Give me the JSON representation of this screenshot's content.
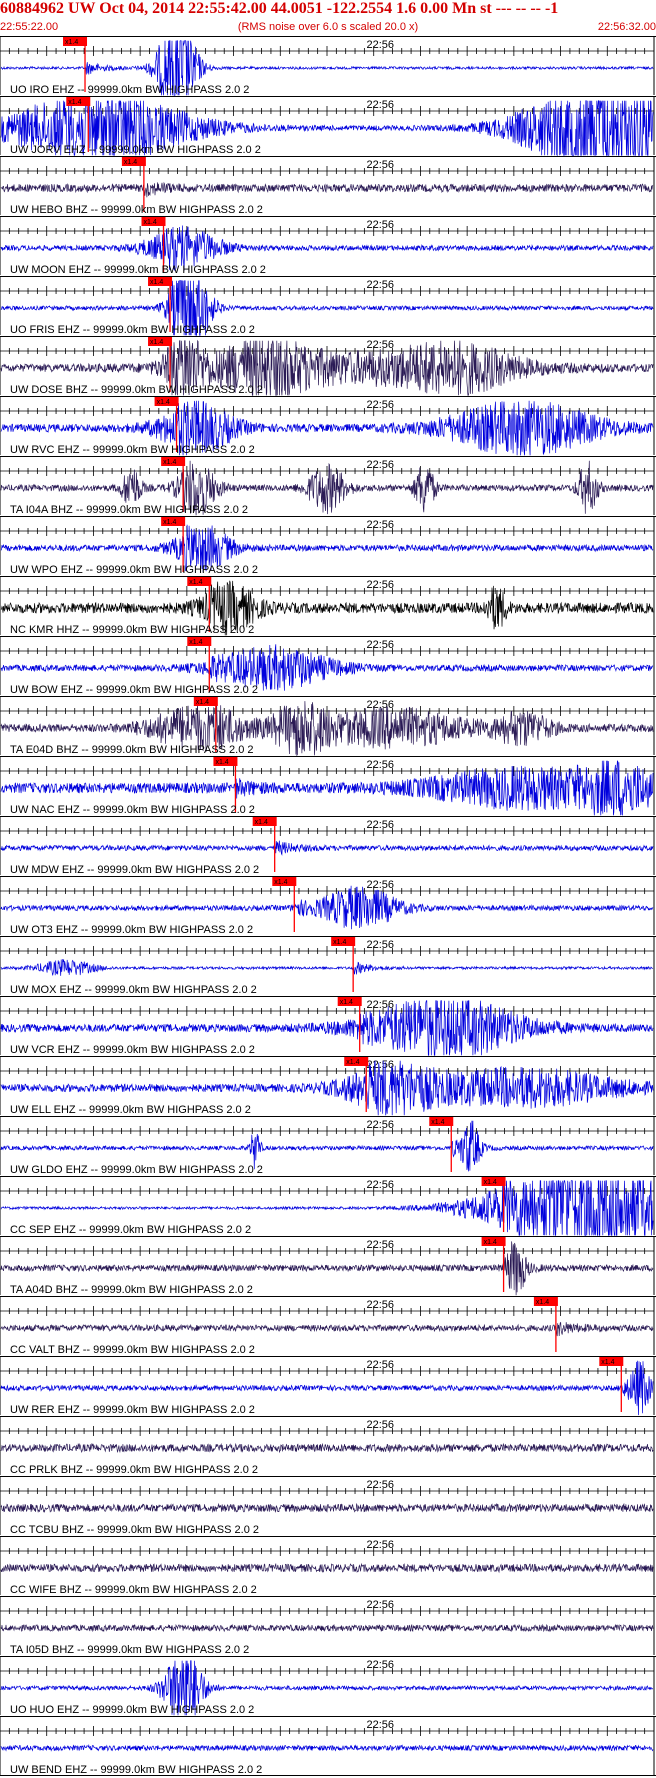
{
  "header": {
    "title": "60884962 UW Oct 04, 2014 22:55:42.00   44.0051 -122.2554  1.6 0.00 Mn st --- -- --   -1",
    "start_time": "22:55:22.00",
    "end_time": "22:56:32.00",
    "rms_note": "(RMS noise over 6.0 s scaled 20.0 x)"
  },
  "time_mark": "22:56",
  "pick_label": "x1.4",
  "colors": {
    "header_text": "#d40000",
    "pick_marker": "#ff0000",
    "blue_trace": "#0000dd",
    "dark_trace": "#2a1a55",
    "black_trace": "#000000",
    "divider": "#000000"
  },
  "traces": [
    {
      "label": "UO IRO EHZ -- 99999.0km BW  HIGHPASS  2.0  2",
      "color": "blue",
      "pick": 0.13,
      "bursts": [
        [
          0.27,
          0.02,
          2.2
        ]
      ],
      "noise": 0.05
    },
    {
      "label": "UW JORV EHZ -- 99999.0km BW  HIGHPASS  2.0  2",
      "color": "blue",
      "pick": 0.135,
      "bursts": [
        [
          0.15,
          0.1,
          1.3
        ],
        [
          0.92,
          0.08,
          2.0
        ]
      ],
      "noise": 0.1
    },
    {
      "label": "UW HEBO BHZ -- 99999.0km BW  HIGHPASS  2.0  2",
      "color": "dark",
      "pick": 0.22,
      "bursts": [],
      "noise": 0.15
    },
    {
      "label": "UW MOON EHZ -- 99999.0km BW  HIGHPASS  2.0  2",
      "color": "blue",
      "pick": 0.25,
      "bursts": [
        [
          0.28,
          0.04,
          0.7
        ]
      ],
      "noise": 0.1
    },
    {
      "label": "UO FRIS EHZ -- 99999.0km BW  HIGHPASS  2.0  2",
      "color": "blue",
      "pick": 0.26,
      "bursts": [
        [
          0.29,
          0.02,
          2.0
        ]
      ],
      "noise": 0.08
    },
    {
      "label": "UW DOSE BHZ -- 99999.0km BW  HIGHPASS  2.0  2",
      "color": "dark",
      "pick": 0.26,
      "bursts": [
        [
          0.28,
          0.02,
          1.2
        ],
        [
          0.4,
          0.05,
          0.9
        ],
        [
          0.55,
          0.15,
          0.5
        ],
        [
          0.7,
          0.06,
          0.7
        ]
      ],
      "noise": 0.15
    },
    {
      "label": "UW RVC EHZ -- 99999.0km BW  HIGHPASS  2.0  2",
      "color": "blue",
      "pick": 0.27,
      "bursts": [
        [
          0.3,
          0.04,
          0.9
        ],
        [
          0.8,
          0.08,
          1.0
        ]
      ],
      "noise": 0.15
    },
    {
      "label": "TA I04A BHZ -- 99999.0km BW  HIGHPASS  2.0  2",
      "color": "dark",
      "pick": 0.28,
      "bursts": [
        [
          0.2,
          0.01,
          0.8
        ],
        [
          0.3,
          0.02,
          1.0
        ],
        [
          0.5,
          0.02,
          0.9
        ],
        [
          0.65,
          0.01,
          1.0
        ],
        [
          0.9,
          0.01,
          1.0
        ]
      ],
      "noise": 0.12
    },
    {
      "label": "UW WPO EHZ -- 99999.0km BW  HIGHPASS  2.0  2",
      "color": "blue",
      "pick": 0.28,
      "bursts": [
        [
          0.31,
          0.03,
          0.8
        ]
      ],
      "noise": 0.12
    },
    {
      "label": "NC KMR HHZ -- 99999.0km BW  HIGHPASS  2.0  2",
      "color": "black",
      "pick": 0.32,
      "bursts": [
        [
          0.35,
          0.03,
          0.8
        ],
        [
          0.76,
          0.01,
          0.8
        ]
      ],
      "noise": 0.2
    },
    {
      "label": "UW BOW EHZ -- 99999.0km BW  HIGHPASS  2.0  2",
      "color": "blue",
      "pick": 0.32,
      "bursts": [
        [
          0.42,
          0.06,
          0.8
        ]
      ],
      "noise": 0.12
    },
    {
      "label": "TA E04D BHZ -- 99999.0km BW  HIGHPASS  2.0  2",
      "color": "dark",
      "pick": 0.33,
      "bursts": [
        [
          0.3,
          0.05,
          0.8
        ],
        [
          0.46,
          0.03,
          0.9
        ],
        [
          0.6,
          0.08,
          0.7
        ],
        [
          0.8,
          0.03,
          0.6
        ]
      ],
      "noise": 0.15
    },
    {
      "label": "UW NAC EHZ -- 99999.0km BW  HIGHPASS  2.0  2",
      "color": "blue",
      "pick": 0.36,
      "bursts": [
        [
          0.8,
          0.1,
          0.7
        ],
        [
          0.95,
          0.04,
          0.8
        ]
      ],
      "noise": 0.2
    },
    {
      "label": "UW MDW EHZ -- 99999.0km BW  HIGHPASS  2.0  2",
      "color": "blue",
      "pick": 0.42,
      "bursts": [],
      "noise": 0.1
    },
    {
      "label": "UW OT3 EHZ -- 99999.0km BW  HIGHPASS  2.0  2",
      "color": "blue",
      "pick": 0.45,
      "bursts": [
        [
          0.55,
          0.04,
          0.8
        ]
      ],
      "noise": 0.1
    },
    {
      "label": "UW MOX EHZ -- 99999.0km BW  HIGHPASS  2.0  2",
      "color": "blue",
      "pick": 0.54,
      "bursts": [
        [
          0.1,
          0.03,
          0.3
        ]
      ],
      "noise": 0.05
    },
    {
      "label": "UW VCR EHZ -- 99999.0km BW  HIGHPASS  2.0  2",
      "color": "blue",
      "pick": 0.55,
      "bursts": [
        [
          0.68,
          0.08,
          1.2
        ]
      ],
      "noise": 0.15
    },
    {
      "label": "UW ELL EHZ -- 99999.0km BW  HIGHPASS  2.0  2",
      "color": "blue",
      "pick": 0.56,
      "bursts": [
        [
          0.6,
          0.05,
          0.9
        ],
        [
          0.8,
          0.1,
          0.7
        ]
      ],
      "noise": 0.15
    },
    {
      "label": "UW GLDO EHZ -- 99999.0km BW  HIGHPASS  2.0  2",
      "color": "blue",
      "pick": 0.69,
      "bursts": [
        [
          0.39,
          0.005,
          0.8
        ],
        [
          0.72,
          0.01,
          1.0
        ]
      ],
      "noise": 0.08
    },
    {
      "label": "CC SEP EHZ -- 99999.0km BW  HIGHPASS  2.0  2",
      "color": "blue",
      "pick": 0.77,
      "bursts": [
        [
          0.9,
          0.1,
          2.0
        ]
      ],
      "noise": 0.05
    },
    {
      "label": "TA A04D BHZ -- 99999.0km BW  HIGHPASS  2.0  2",
      "color": "dark",
      "pick": 0.77,
      "bursts": [
        [
          0.79,
          0.01,
          1.0
        ]
      ],
      "noise": 0.12
    },
    {
      "label": "CC VALT BHZ -- 99999.0km BW  HIGHPASS  2.0  2",
      "color": "dark",
      "pick": 0.85,
      "bursts": [],
      "noise": 0.12
    },
    {
      "label": "UW RER EHZ -- 99999.0km BW  HIGHPASS  2.0  2",
      "color": "blue",
      "pick": 0.95,
      "bursts": [
        [
          0.98,
          0.01,
          1.0
        ]
      ],
      "noise": 0.1
    },
    {
      "label": "CC PRLK BHZ -- 99999.0km BW  HIGHPASS  2.0  2",
      "color": "dark",
      "pick": null,
      "bursts": [],
      "noise": 0.15
    },
    {
      "label": "CC TCBU BHZ -- 99999.0km BW  HIGHPASS  2.0  2",
      "color": "dark",
      "pick": null,
      "bursts": [],
      "noise": 0.15
    },
    {
      "label": "CC WIFE BHZ -- 99999.0km BW  HIGHPASS  2.0  2",
      "color": "dark",
      "pick": null,
      "bursts": [],
      "noise": 0.15
    },
    {
      "label": "TA I05D BHZ -- 99999.0km BW  HIGHPASS  2.0  2",
      "color": "dark",
      "pick": null,
      "bursts": [],
      "noise": 0.12
    },
    {
      "label": "UO HUO EHZ -- 99999.0km BW  HIGHPASS  2.0  2",
      "color": "blue",
      "pick": null,
      "bursts": [
        [
          0.28,
          0.02,
          1.6
        ]
      ],
      "noise": 0.08
    },
    {
      "label": "UW BEND EHZ -- 99999.0km BW  HIGHPASS  2.0  2",
      "color": "blue",
      "pick": null,
      "bursts": [],
      "noise": 0.1
    }
  ]
}
